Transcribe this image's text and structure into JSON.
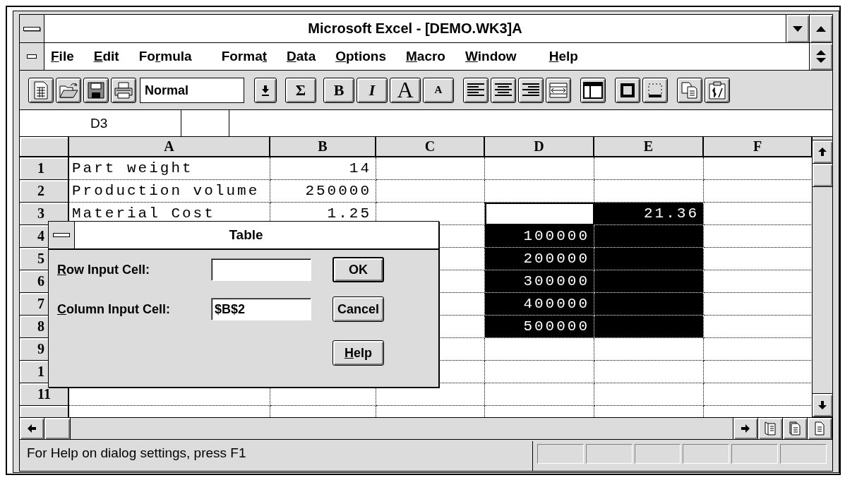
{
  "window": {
    "title": "Microsoft Excel - [DEMO.WK3]A"
  },
  "menu": [
    {
      "key": "F",
      "post": "ile"
    },
    {
      "key": "E",
      "post": "dit"
    },
    {
      "pre": "Fo",
      "key": "r",
      "post": "mula"
    },
    {
      "pre": "Forma",
      "key": "t"
    },
    {
      "key": "D",
      "post": "ata"
    },
    {
      "key": "O",
      "post": "ptions"
    },
    {
      "key": "M",
      "post": "acro"
    },
    {
      "key": "W",
      "post": "indow"
    },
    {
      "key": "H",
      "post": "elp"
    }
  ],
  "toolbar": {
    "style": "Normal",
    "glyphs": [
      "Σ",
      "B",
      "I",
      "A",
      "A"
    ]
  },
  "formula_bar": {
    "name_box": "D3"
  },
  "sheet": {
    "columns": [
      "A",
      "B",
      "C",
      "D",
      "E",
      "F"
    ],
    "rows": [
      {
        "header": "1",
        "cells": [
          {
            "kind": "text",
            "text": "Part weight"
          },
          {
            "kind": "number",
            "text": "14"
          }
        ]
      },
      {
        "header": "2",
        "cells": [
          {
            "kind": "text",
            "text": "Production volume"
          },
          {
            "kind": "number",
            "text": "250000"
          }
        ]
      },
      {
        "header": "3",
        "cells": [
          {
            "kind": "text",
            "text": "Material Cost"
          },
          {
            "kind": "number",
            "text": "1.25"
          },
          {
            "kind": "empty"
          },
          {
            "kind": "number",
            "selected": true,
            "active": true
          },
          {
            "kind": "number",
            "text": "21.36",
            "selected": true,
            "active": false
          }
        ]
      },
      {
        "header": "4",
        "cells": [
          {
            "kind": "covered"
          },
          {
            "kind": "covered"
          },
          {
            "kind": "empty"
          },
          {
            "kind": "number",
            "text": "100000",
            "selected": true,
            "active": false
          },
          {
            "kind": "number",
            "selected": true,
            "active": false
          }
        ]
      },
      {
        "header": "5",
        "cells": [
          {
            "kind": "covered"
          },
          {
            "kind": "covered"
          },
          {
            "kind": "empty"
          },
          {
            "kind": "number",
            "text": "200000",
            "selected": true,
            "active": false
          },
          {
            "kind": "number",
            "selected": true,
            "active": false
          }
        ]
      },
      {
        "header": "6",
        "cells": [
          {
            "kind": "covered"
          },
          {
            "kind": "covered"
          },
          {
            "kind": "empty"
          },
          {
            "kind": "number",
            "text": "300000",
            "selected": true,
            "active": false
          },
          {
            "kind": "number",
            "selected": true,
            "active": false
          }
        ]
      },
      {
        "header": "7",
        "cells": [
          {
            "kind": "covered"
          },
          {
            "kind": "covered"
          },
          {
            "kind": "empty"
          },
          {
            "kind": "number",
            "text": "400000",
            "selected": true,
            "active": false
          },
          {
            "kind": "number",
            "selected": true,
            "active": false
          }
        ]
      },
      {
        "header": "8",
        "cells": [
          {
            "kind": "covered"
          },
          {
            "kind": "covered"
          },
          {
            "kind": "empty"
          },
          {
            "kind": "number",
            "text": "500000",
            "selected": true,
            "active": false
          },
          {
            "kind": "number",
            "selected": true,
            "active": false
          }
        ]
      },
      {
        "header": "9",
        "cells": [
          {
            "kind": "covered"
          },
          {
            "kind": "covered"
          }
        ]
      },
      {
        "header": "1",
        "cells": [
          {
            "kind": "covered"
          },
          {
            "kind": "covered"
          }
        ]
      },
      {
        "header": "11"
      },
      {}
    ]
  },
  "dialog": {
    "title": "Table",
    "fields": [
      {
        "key": "R",
        "post": "ow Input Cell:"
      },
      {
        "key": "C",
        "post": "olumn Input Cell:",
        "value": "$B$2"
      }
    ],
    "buttons": [
      {
        "pre": "OK",
        "default": true
      },
      {
        "pre": "Cancel",
        "default": false
      },
      {
        "key": "H",
        "post": "elp",
        "default": false
      }
    ]
  },
  "status_bar": {
    "text": "For Help on dialog settings, press F1"
  }
}
